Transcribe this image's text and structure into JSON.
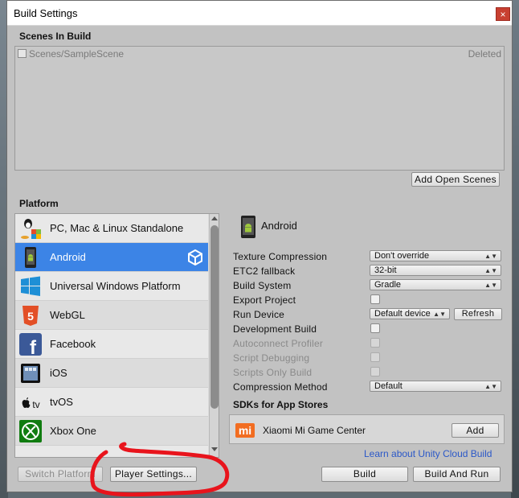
{
  "window": {
    "title": "Build Settings",
    "close_glyph": "×"
  },
  "scenes": {
    "heading": "Scenes In Build",
    "items": [
      {
        "name": "Scenes/SampleScene",
        "status": "Deleted"
      }
    ],
    "add_open_scenes_label": "Add Open Scenes"
  },
  "platform": {
    "heading": "Platform",
    "items": [
      {
        "label": "PC, Mac & Linux Standalone",
        "icon": "pc-mac-linux-icon"
      },
      {
        "label": "Android",
        "icon": "android-icon",
        "selected": true
      },
      {
        "label": "Universal Windows Platform",
        "icon": "windows-icon"
      },
      {
        "label": "WebGL",
        "icon": "html5-icon",
        "icon_text": "5"
      },
      {
        "label": "Facebook",
        "icon": "facebook-icon",
        "icon_text": "f"
      },
      {
        "label": "iOS",
        "icon": "ipad-icon"
      },
      {
        "label": "tvOS",
        "icon": "apple-tv-icon",
        "icon_text": "tv"
      },
      {
        "label": "Xbox One",
        "icon": "xbox-icon"
      }
    ]
  },
  "selected_platform": {
    "name": "Android",
    "settings": [
      {
        "label": "Texture Compression",
        "type": "dropdown",
        "value": "Don't override"
      },
      {
        "label": "ETC2 fallback",
        "type": "dropdown",
        "value": "32-bit"
      },
      {
        "label": "Build System",
        "type": "dropdown",
        "value": "Gradle"
      },
      {
        "label": "Export Project",
        "type": "checkbox",
        "checked": false
      },
      {
        "label": "Run Device",
        "type": "dropdown",
        "value": "Default device",
        "button": "Refresh"
      },
      {
        "label": "Development Build",
        "type": "checkbox",
        "checked": false
      },
      {
        "label": "Autoconnect Profiler",
        "type": "checkbox",
        "checked": false,
        "disabled": true
      },
      {
        "label": "Script Debugging",
        "type": "checkbox",
        "checked": false,
        "disabled": true
      },
      {
        "label": "Scripts Only Build",
        "type": "checkbox",
        "checked": false,
        "disabled": true
      },
      {
        "label": "Compression Method",
        "type": "dropdown",
        "value": "Default"
      }
    ],
    "dropdown_arrow": "▲▼"
  },
  "sdks": {
    "heading": "SDKs for App Stores",
    "items": [
      {
        "name": "Xiaomi Mi Game Center",
        "logo_text": "mi",
        "button": "Add"
      }
    ]
  },
  "cloud_link": "Learn about Unity Cloud Build",
  "buttons": {
    "switch_platform": "Switch Platform",
    "player_settings": "Player Settings...",
    "build": "Build",
    "build_and_run": "Build And Run"
  },
  "colors": {
    "selection": "#3c84e6",
    "window_bg": "#c2c2c2",
    "link": "#2b58c8",
    "annotation": "#e8141c"
  }
}
